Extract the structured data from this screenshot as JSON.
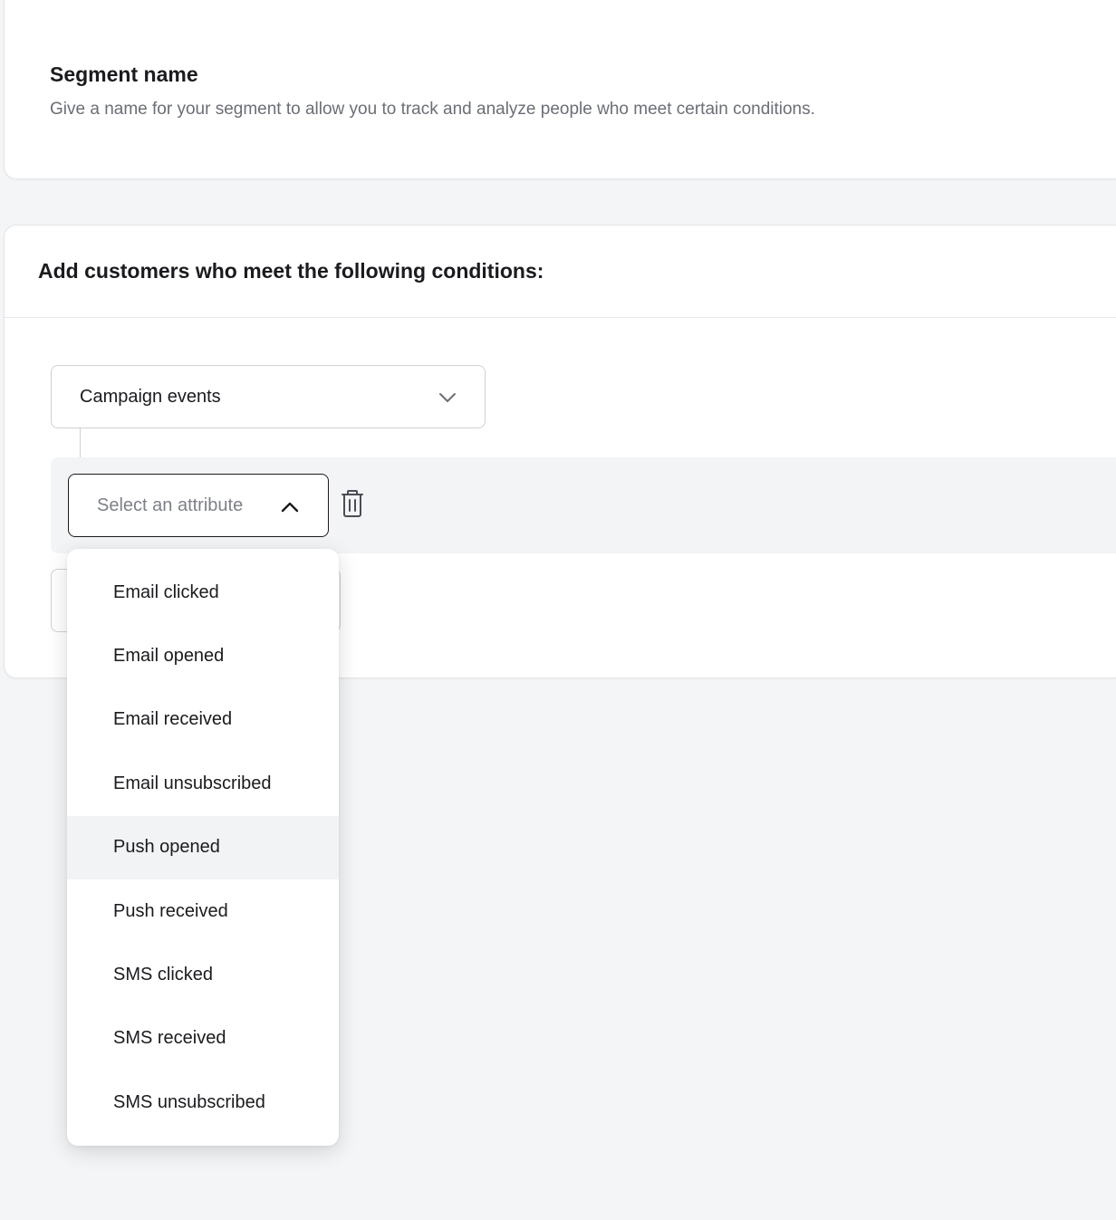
{
  "segment": {
    "title": "Segment name",
    "description": "Give a name for your segment to allow you to track and analyze people who meet certain conditions."
  },
  "conditions": {
    "heading": "Add customers who meet the following conditions:",
    "event_type": {
      "value": "Campaign events",
      "icon": "chevron-down-icon"
    },
    "attribute": {
      "placeholder": "Select an attribute",
      "icon": "chevron-up-icon",
      "delete_icon": "trash-icon",
      "options": [
        "Email clicked",
        "Email opened",
        "Email received",
        "Email unsubscribed",
        "Push opened",
        "Push received",
        "SMS clicked",
        "SMS received",
        "SMS unsubscribed"
      ],
      "hovered_option": "Push opened"
    }
  },
  "colors": {
    "page_background": "#f4f5f7",
    "card_background": "#ffffff",
    "text_primary": "#1b1b1f",
    "text_secondary": "#6b6e75",
    "hover_background": "#f2f3f5"
  }
}
